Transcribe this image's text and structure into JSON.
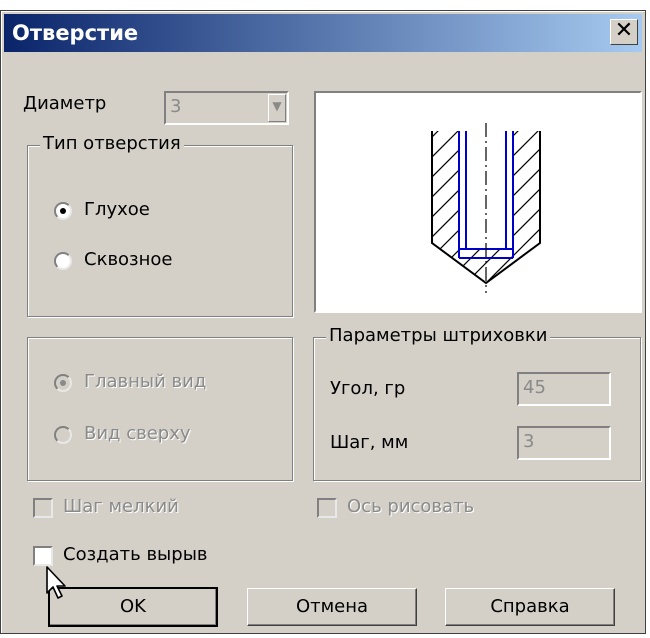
{
  "window": {
    "title": "Отверстие",
    "close_glyph": "✕"
  },
  "diameter": {
    "label": "Диаметр",
    "value": "3",
    "arrow": "▼"
  },
  "hole_type": {
    "legend": "Тип отверстия",
    "options": [
      {
        "label": "Глухое",
        "selected": true
      },
      {
        "label": "Сквозное",
        "selected": false
      }
    ]
  },
  "view": {
    "options": [
      {
        "label": "Главный вид",
        "selected": true
      },
      {
        "label": "Вид сверху",
        "selected": false
      }
    ]
  },
  "hatch": {
    "legend": "Параметры штриховки",
    "angle_label": "Угол, гр",
    "angle_value": "45",
    "step_label": "Шаг, мм",
    "step_value": "3"
  },
  "checkboxes": {
    "fine_step": "Шаг мелкий",
    "draw_axis": "Ось рисовать",
    "create_cutout": "Создать вырыв"
  },
  "buttons": {
    "ok": "OK",
    "cancel": "Отмена",
    "help": "Справка"
  },
  "preview": {
    "line_color": "#0000cc",
    "hatch_color": "#000000"
  }
}
